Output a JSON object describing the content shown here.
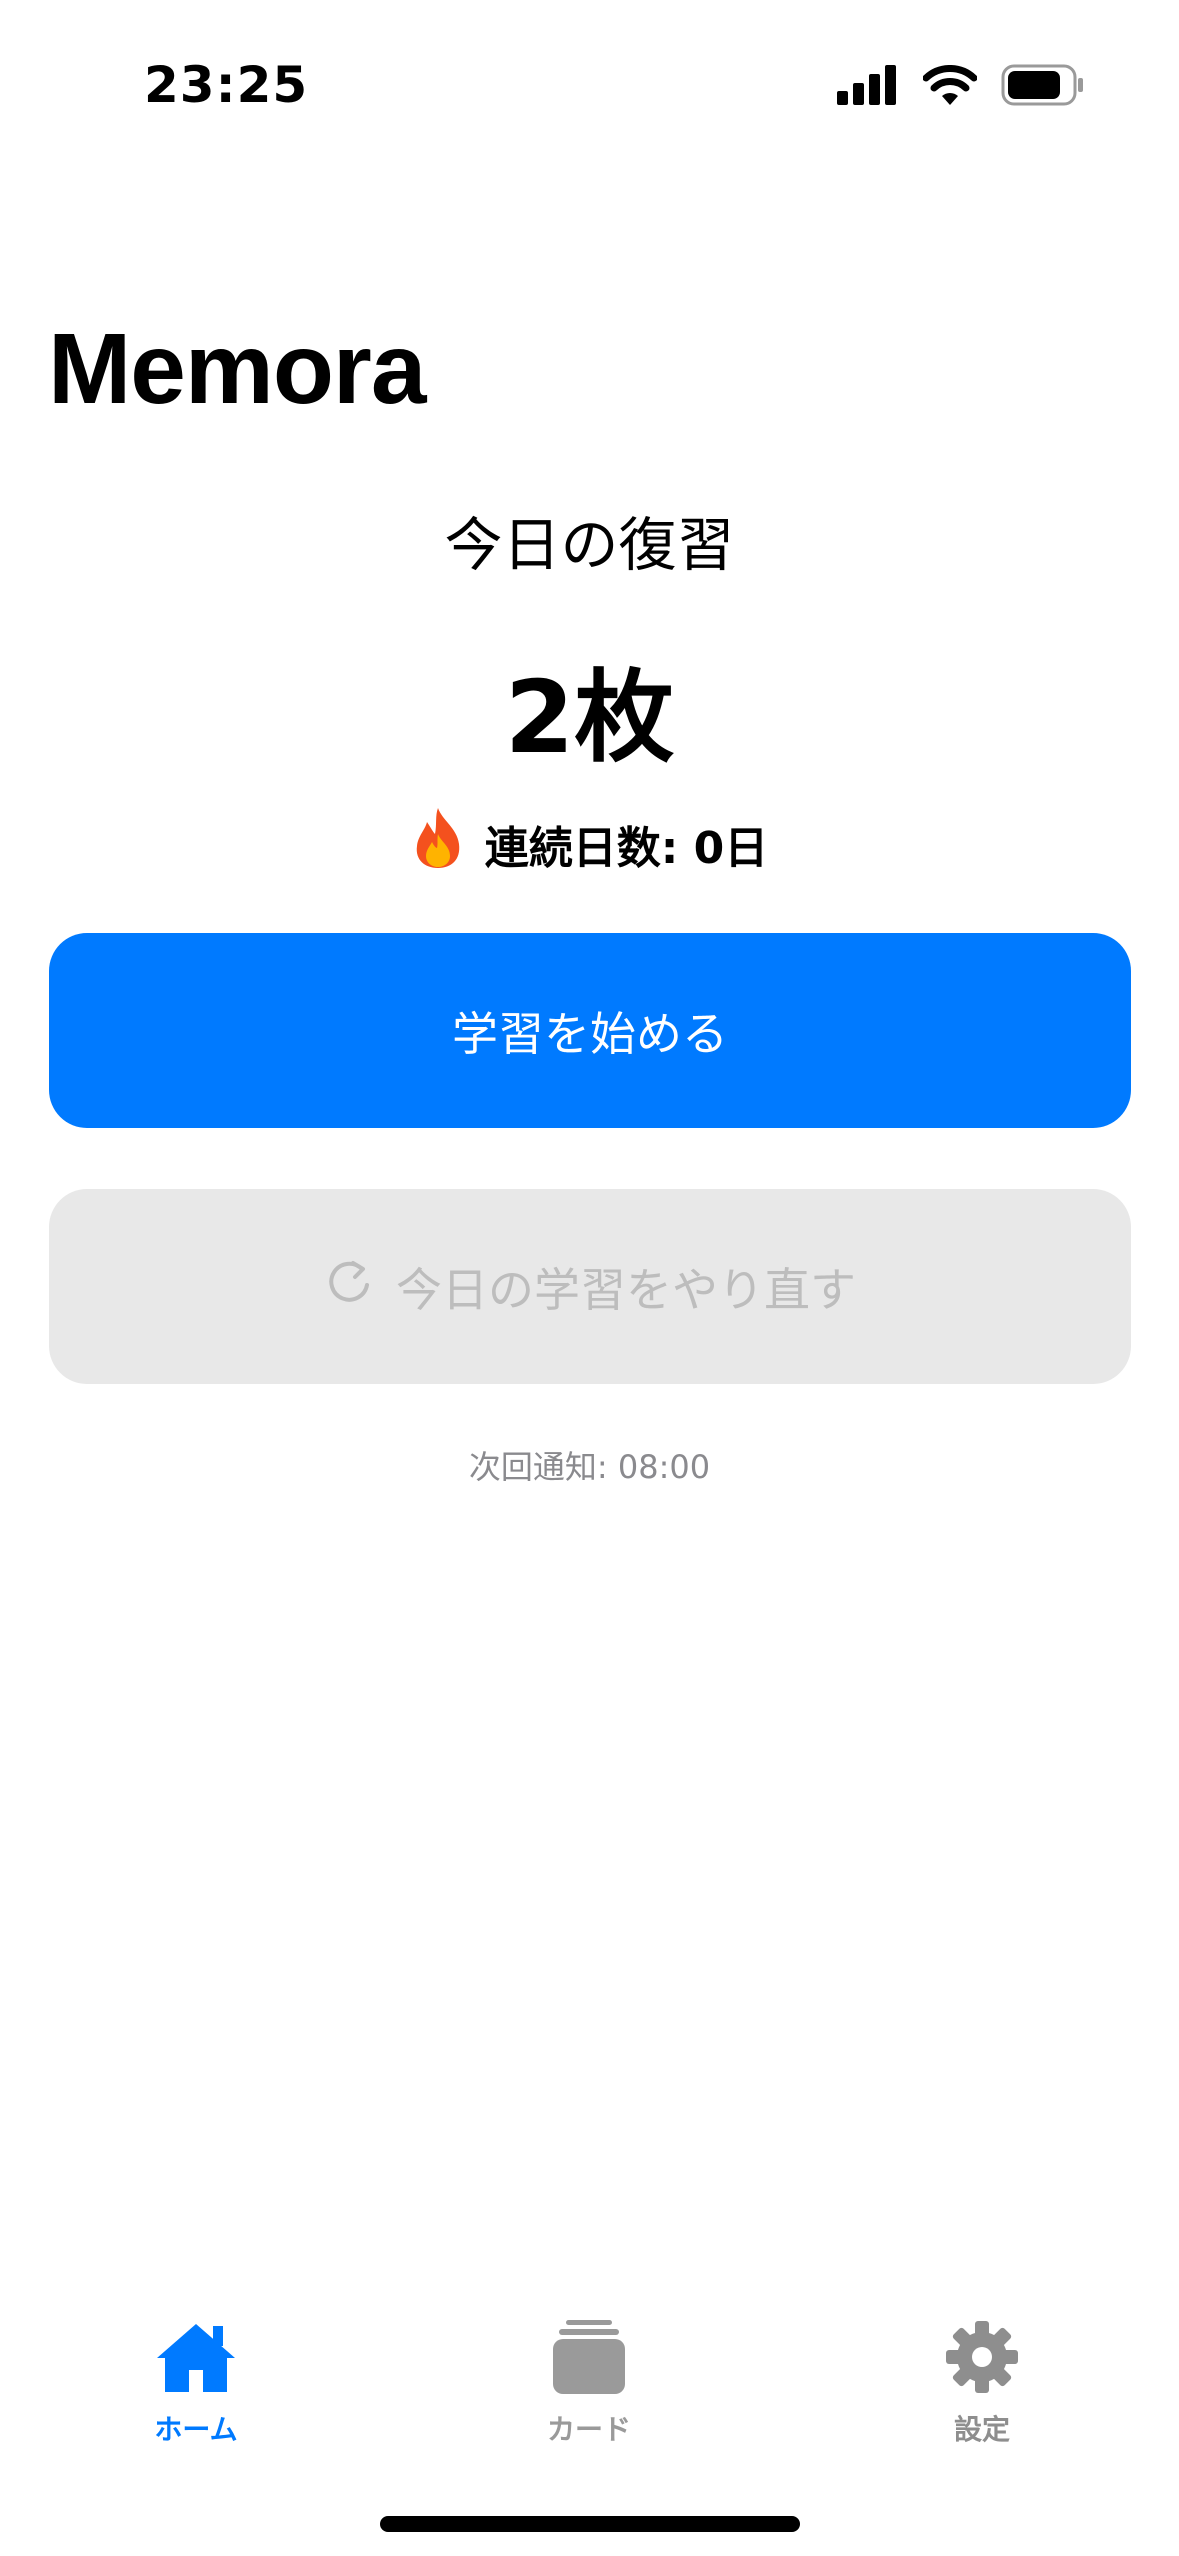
{
  "status_bar": {
    "time": "23:25"
  },
  "app": {
    "title": "Memora"
  },
  "review": {
    "label": "今日の復習",
    "count": "2枚"
  },
  "streak": {
    "icon": "fire-icon",
    "text": "連続日数: 0日"
  },
  "buttons": {
    "start_label": "学習を始める",
    "redo_label": "今日の学習をやり直す",
    "redo_icon": "refresh-icon"
  },
  "notice": {
    "next_notification": "次回通知: 08:00"
  },
  "tabs": [
    {
      "label": "ホーム",
      "icon": "house-icon",
      "selected": true
    },
    {
      "label": "カード",
      "icon": "card-stack-icon",
      "selected": false
    },
    {
      "label": "設定",
      "icon": "gear-icon",
      "selected": false
    }
  ],
  "colors": {
    "accent": "#007aff",
    "disabled_bg": "#e8e8e8",
    "disabled_text": "#bdbdbd",
    "secondary_text": "#8a8a8e"
  }
}
